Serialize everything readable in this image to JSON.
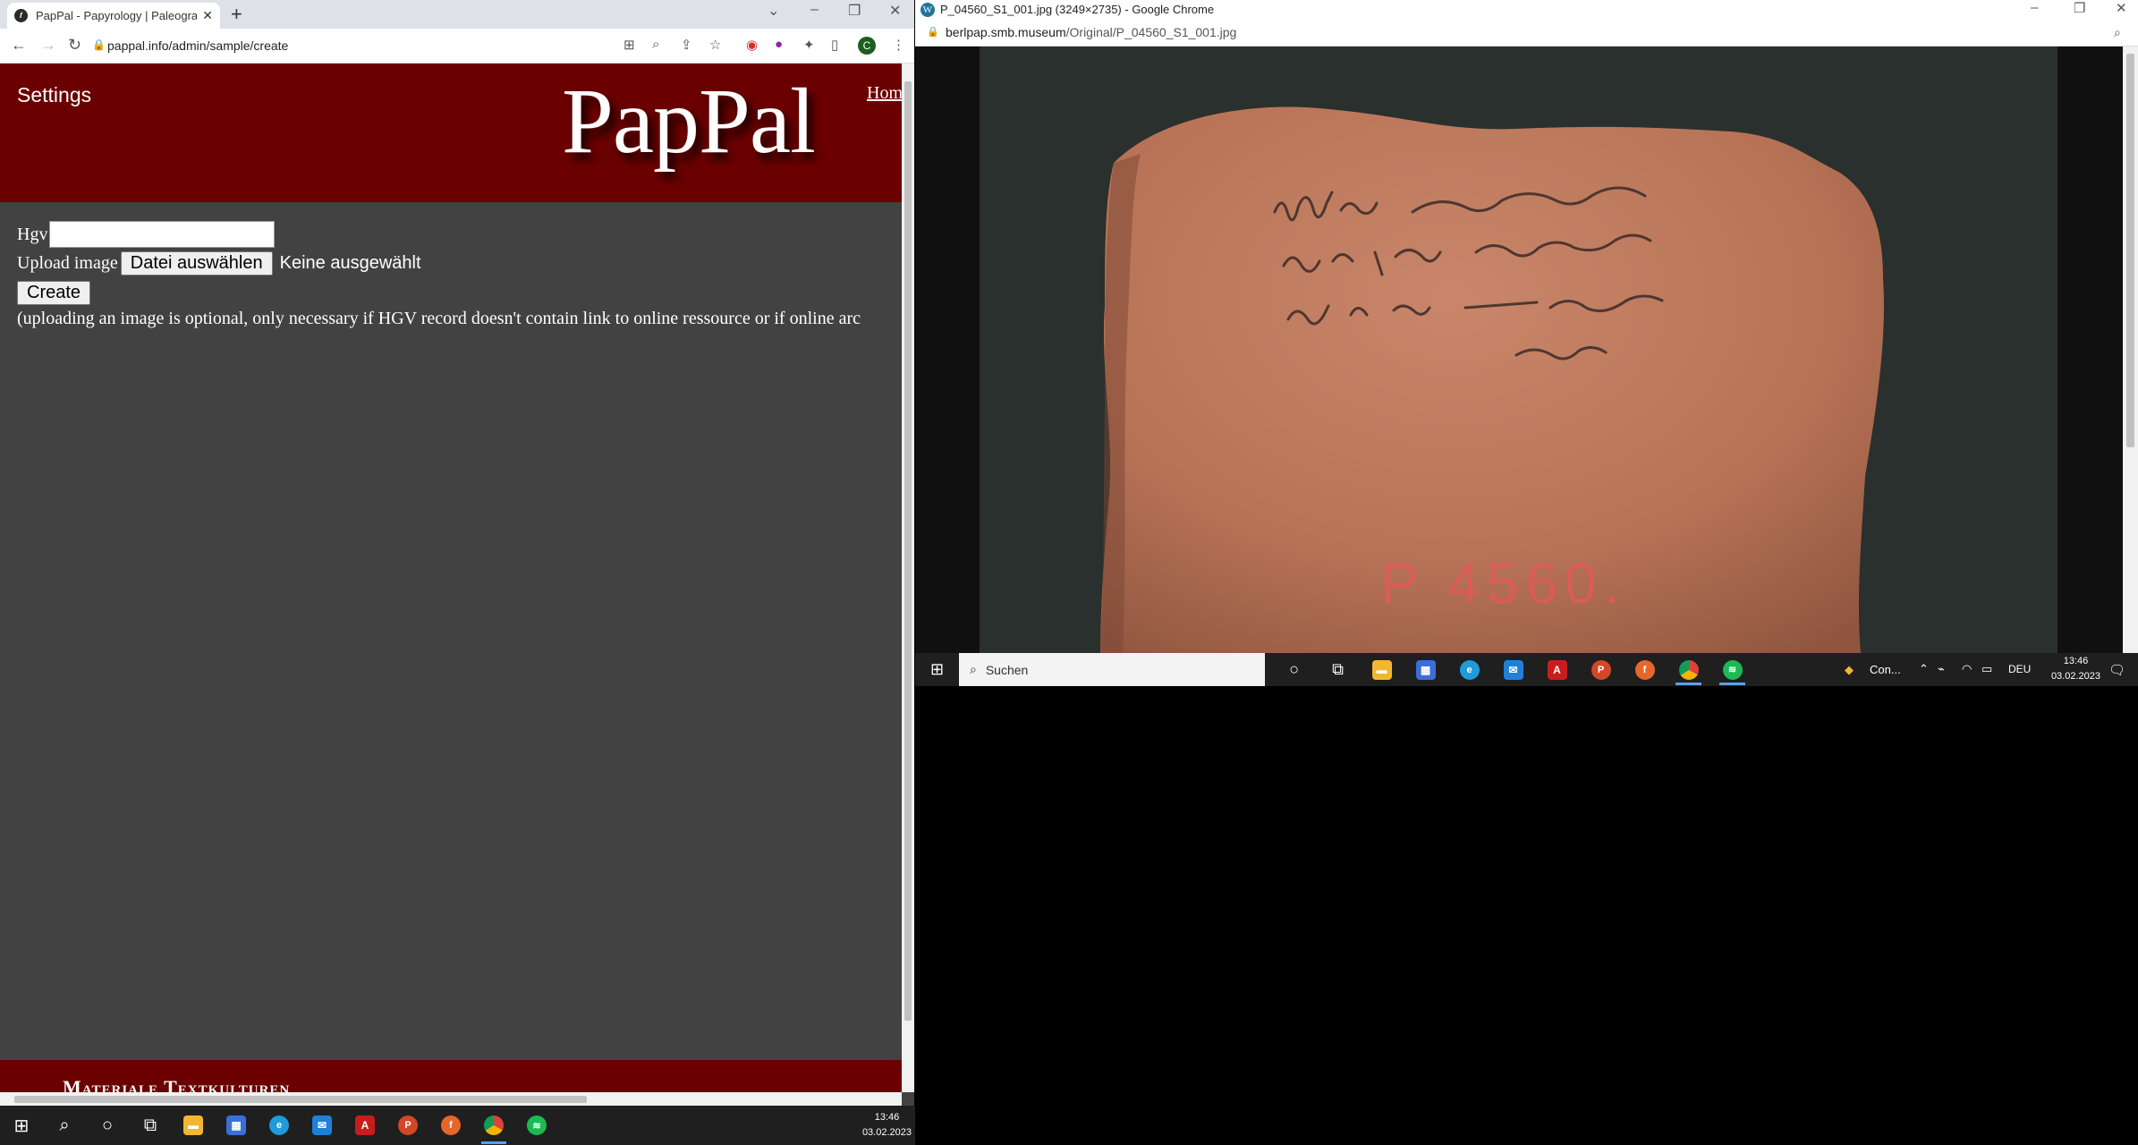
{
  "left_browser": {
    "tab_title": "PapPal - Papyrology | Paleograph",
    "url": "pappal.info/admin/sample/create",
    "profile_initial": "C",
    "page": {
      "settings_label": "Settings",
      "logo": "PapPal",
      "home_link": "Hom",
      "hgv_label": "Hgv",
      "hgv_value": "",
      "upload_label": "Upload image",
      "file_button": "Datei auswählen",
      "file_status": "Keine ausgewählt",
      "create_button": "Create",
      "note": "(uploading an image is optional, only necessary if HGV record doesn't contain link to online ressource or if online arc",
      "footer_text": "Materiale Textkulturen"
    }
  },
  "right_browser": {
    "window_title": "P_04560_S1_001.jpg (3249×2735) - Google Chrome",
    "url_host": "berlpap.smb.museum",
    "url_path": "/Original/P_04560_S1_001.jpg",
    "image_label": "P 4560."
  },
  "taskbar_left": {
    "time": "13:46",
    "date": "03.02.2023"
  },
  "taskbar_right": {
    "search_placeholder": "Suchen",
    "weather_text": "Con...",
    "language": "DEU",
    "time": "13:46",
    "date": "03.02.2023"
  }
}
